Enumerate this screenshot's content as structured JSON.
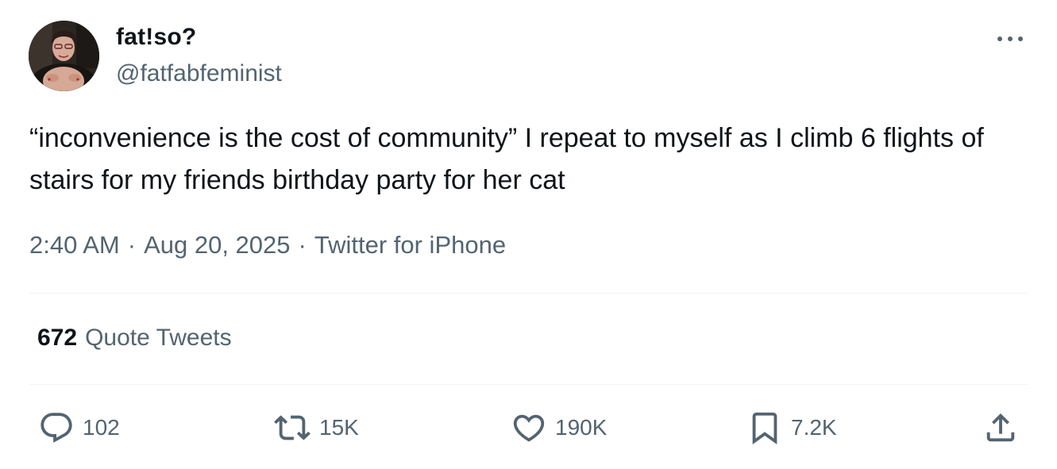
{
  "tweet": {
    "author_name": "fat!so?",
    "author_handle": "@fatfabfeminist",
    "text": "“inconvenience is the cost of community” I repeat to myself as I climb 6 flights of stairs for my friends birthday party for her cat",
    "time": "2:40 AM",
    "date": "Aug 20, 2025",
    "source": "Twitter for iPhone",
    "separator": "·"
  },
  "stats": {
    "quote_count": "672",
    "quote_label": "Quote Tweets"
  },
  "actions": {
    "replies": "102",
    "retweets": "15K",
    "likes": "190K",
    "bookmarks": "7.2K"
  },
  "icons": {
    "more": "more-horizontal-icon",
    "reply": "reply-icon",
    "retweet": "retweet-icon",
    "like": "heart-icon",
    "bookmark": "bookmark-icon",
    "share": "share-icon"
  },
  "colors": {
    "text_primary": "#0f1419",
    "text_secondary": "#536471",
    "divider": "#eff3f4"
  }
}
